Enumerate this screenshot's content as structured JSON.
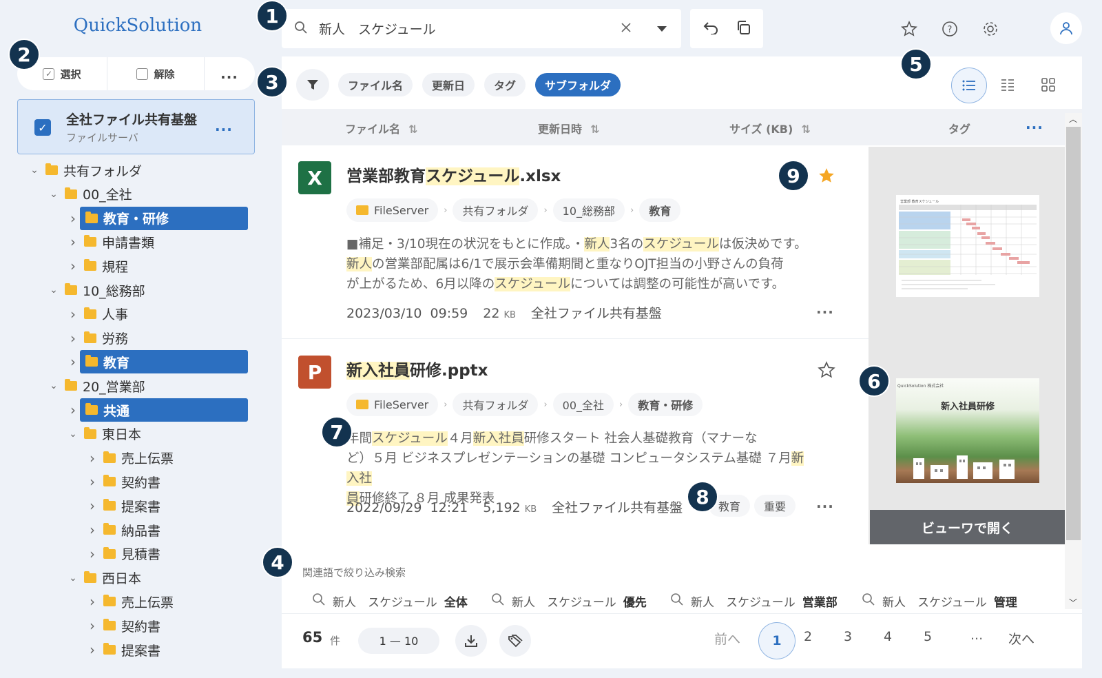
{
  "app": {
    "logo": "QuickSolution"
  },
  "sidebar": {
    "select_label": "選択",
    "deselect_label": "解除",
    "more": "...",
    "root": {
      "title": "全社ファイル共有基盤",
      "subtitle": "ファイルサーバ",
      "more": "..."
    },
    "tree": [
      {
        "label": "共有フォルダ",
        "level": 0,
        "expanded": true,
        "selected": false
      },
      {
        "label": "00_全社",
        "level": 1,
        "expanded": true,
        "selected": false
      },
      {
        "label": "教育・研修",
        "level": 2,
        "expanded": false,
        "selected": true
      },
      {
        "label": "申請書類",
        "level": 2,
        "expanded": false,
        "selected": false
      },
      {
        "label": "規程",
        "level": 2,
        "expanded": false,
        "selected": false
      },
      {
        "label": "10_総務部",
        "level": 1,
        "expanded": true,
        "selected": false
      },
      {
        "label": "人事",
        "level": 2,
        "expanded": false,
        "selected": false
      },
      {
        "label": "労務",
        "level": 2,
        "expanded": false,
        "selected": false
      },
      {
        "label": "教育",
        "level": 2,
        "expanded": false,
        "selected": true
      },
      {
        "label": "20_営業部",
        "level": 1,
        "expanded": true,
        "selected": false
      },
      {
        "label": "共通",
        "level": 2,
        "expanded": false,
        "selected": true
      },
      {
        "label": "東日本",
        "level": 2,
        "expanded": true,
        "selected": false
      },
      {
        "label": "売上伝票",
        "level": 3,
        "expanded": false,
        "selected": false
      },
      {
        "label": "契約書",
        "level": 3,
        "expanded": false,
        "selected": false
      },
      {
        "label": "提案書",
        "level": 3,
        "expanded": false,
        "selected": false
      },
      {
        "label": "納品書",
        "level": 3,
        "expanded": false,
        "selected": false
      },
      {
        "label": "見積書",
        "level": 3,
        "expanded": false,
        "selected": false
      },
      {
        "label": "西日本",
        "level": 2,
        "expanded": true,
        "selected": false
      },
      {
        "label": "売上伝票",
        "level": 3,
        "expanded": false,
        "selected": false
      },
      {
        "label": "契約書",
        "level": 3,
        "expanded": false,
        "selected": false
      },
      {
        "label": "提案書",
        "level": 3,
        "expanded": false,
        "selected": false
      }
    ]
  },
  "search": {
    "value": "新人　スケジュール"
  },
  "filters": {
    "chips": [
      "ファイル名",
      "更新日",
      "タグ",
      "サブフォルダ"
    ],
    "active": "サブフォルダ"
  },
  "columns": {
    "name": "ファイル名",
    "updated": "更新日時",
    "size": "サイズ (KB)",
    "tags": "タグ",
    "more": "..."
  },
  "results": [
    {
      "icon_letter": "X",
      "icon_color": "#1e7145",
      "title_parts": [
        {
          "text": "営業部教育",
          "hl": false
        },
        {
          "text": "スケジュール",
          "hl": true
        },
        {
          "text": ".xlsx",
          "hl": false
        }
      ],
      "starred": true,
      "path": [
        "FileServer",
        "共有フォルダ",
        "10_総務部",
        "教育"
      ],
      "snippet_lines": [
        [
          {
            "text": "■補足・3/10現在の状況をもとに作成。・",
            "hl": false
          },
          {
            "text": "新人",
            "hl": true
          },
          {
            "text": "3名の",
            "hl": false
          },
          {
            "text": "スケジュール",
            "hl": true
          },
          {
            "text": "は仮決めです。",
            "hl": false
          }
        ],
        [
          {
            "text": "新人",
            "hl": true
          },
          {
            "text": "の営業部配属は6/1で展示会準備期間と重なりOJT担当の小野さんの負荷",
            "hl": false
          }
        ],
        [
          {
            "text": "が上がるため、6月以降の",
            "hl": false
          },
          {
            "text": "スケジュール",
            "hl": true
          },
          {
            "text": "については調整の可能性が高いです。",
            "hl": false
          }
        ]
      ],
      "date": "2023/03/10",
      "time": "09:59",
      "size": "22",
      "size_unit": "KB",
      "source": "全社ファイル共有基盤",
      "tags": [],
      "more": "..."
    },
    {
      "icon_letter": "P",
      "icon_color": "#c1502e",
      "title_parts": [
        {
          "text": "新入社員",
          "hl": true
        },
        {
          "text": "研修.pptx",
          "hl": false
        }
      ],
      "starred": false,
      "path": [
        "FileServer",
        "共有フォルダ",
        "00_全社",
        "教育・研修"
      ],
      "snippet_lines": [
        [
          {
            "text": "年間",
            "hl": false
          },
          {
            "text": "スケジュール",
            "hl": true
          },
          {
            "text": "４月",
            "hl": false
          },
          {
            "text": "新入社員",
            "hl": true
          },
          {
            "text": "研修スタート 社会人基礎教育（マナーな",
            "hl": false
          }
        ],
        [
          {
            "text": "ど）５月 ビジネスプレゼンテーションの基礎 コンピュータシステム基礎 ７月",
            "hl": false
          },
          {
            "text": "新入社",
            "hl": true
          }
        ],
        [
          {
            "text": "員",
            "hl": true
          },
          {
            "text": "研修終了 ８月 成果発表",
            "hl": false
          }
        ]
      ],
      "date": "2022/09/29",
      "time": "12:21",
      "size": "5,192",
      "size_unit": "KB",
      "source": "全社ファイル共有基盤",
      "tags": [
        "教育",
        "重要"
      ],
      "more": "..."
    }
  ],
  "preview": {
    "open_button": "ビューワで開く",
    "slide_title": "新入社員研修",
    "slide_header": "QuickSolution 株式会社",
    "sheet_title": "営業部 教育スケジュール"
  },
  "related": {
    "label": "関連語で絞り込み検索",
    "items": [
      {
        "query": "新人　スケジュール",
        "term": "全体"
      },
      {
        "query": "新人　スケジュール",
        "term": "優先"
      },
      {
        "query": "新人　スケジュール",
        "term": "営業部"
      },
      {
        "query": "新人　スケジュール",
        "term": "管理"
      }
    ]
  },
  "footer": {
    "count": "65",
    "count_unit": "件",
    "range": "1 — 10",
    "prev": "前へ",
    "pages": [
      "1",
      "2",
      "3",
      "4",
      "5"
    ],
    "current_page": "1",
    "ellipsis": "...",
    "next": "次へ"
  },
  "badges": [
    "1",
    "2",
    "3",
    "4",
    "5",
    "6",
    "7",
    "8",
    "9"
  ],
  "colors": {
    "accent": "#2c6fc0",
    "badge": "#13334f",
    "highlight": "#fff5c2",
    "star": "#f5a623",
    "folder": "#f5b82e"
  }
}
